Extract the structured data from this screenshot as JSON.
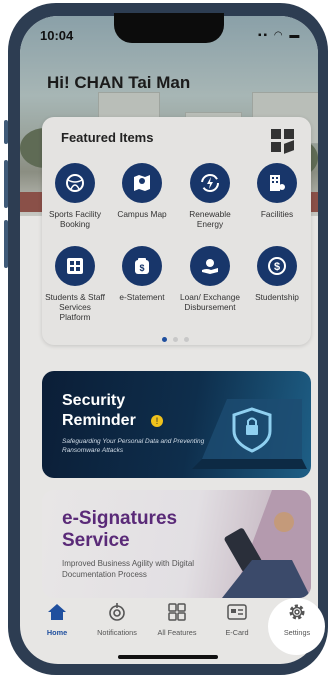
{
  "status_bar": {
    "time": "10:04"
  },
  "greeting": "Hi! CHAN Tai Man",
  "featured": {
    "title": "Featured Items",
    "items": [
      {
        "label": "Sports Facility Booking",
        "icon": "sports-icon"
      },
      {
        "label": "Campus Map",
        "icon": "map-icon"
      },
      {
        "label": "Renewable Energy",
        "icon": "energy-icon"
      },
      {
        "label": "Facilities",
        "icon": "building-icon"
      },
      {
        "label": "Students & Staff Services Platform",
        "icon": "services-icon"
      },
      {
        "label": "e-Statement",
        "icon": "wallet-icon"
      },
      {
        "label": "Loan/ Exchange Disbursement",
        "icon": "loan-icon"
      },
      {
        "label": "Studentship",
        "icon": "dollar-icon"
      }
    ],
    "page_indicator": {
      "current": 1,
      "total": 3
    }
  },
  "banners": [
    {
      "title": "Security Reminder",
      "subtitle": "Safeguarding Your Personal Data and Preventing Ransomware Attacks"
    },
    {
      "title": "e-Signatures Service",
      "subtitle": "Improved Business Agility with Digital Documentation Process"
    }
  ],
  "tabs": [
    {
      "label": "Home",
      "active": true
    },
    {
      "label": "Notifications"
    },
    {
      "label": "All Features"
    },
    {
      "label": "E-Card"
    },
    {
      "label": "Settings",
      "highlighted": true
    }
  ],
  "colors": {
    "accent": "#1f4f9e",
    "icon_bg": "#18366a",
    "banner2_title": "#5a2a78"
  }
}
